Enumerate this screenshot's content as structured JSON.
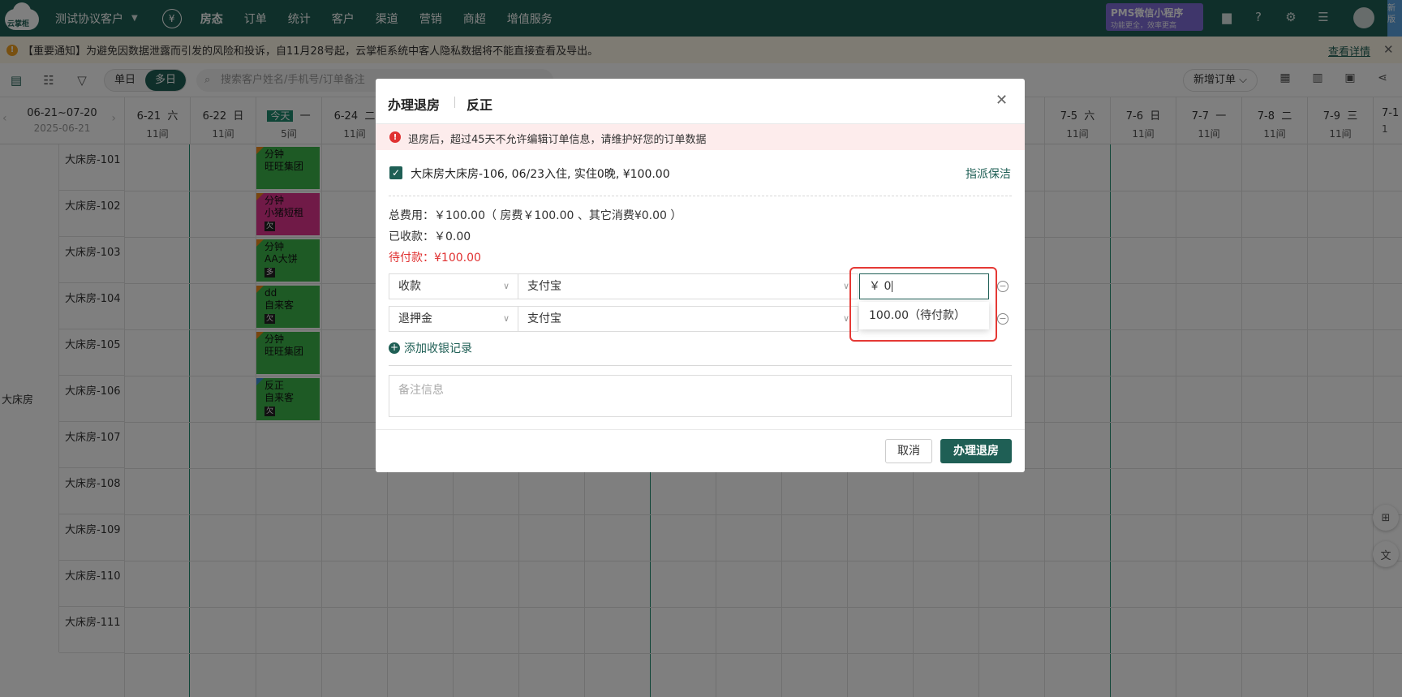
{
  "topnav": {
    "logo_text": "云掌柜",
    "hotel_name": "测试协议客户",
    "links": [
      "房态",
      "订单",
      "统计",
      "客户",
      "渠道",
      "营销",
      "商超",
      "增值服务"
    ],
    "active_link": "房态",
    "pms_title": "PMS微信小程序",
    "pms_subtitle": "功能更全，效率更高",
    "corner_badge": "新版"
  },
  "notice": {
    "text": "【重要通知】为避免因数据泄露而引发的风险和投诉，自11月28号起，云掌柜系统中客人隐私数据将不能直接查看及导出。",
    "link": "查看详情"
  },
  "toolbar": {
    "single_day": "单日",
    "multi_day": "多日",
    "search_placeholder": "搜索客户姓名/手机号/订单备注",
    "new_order": "新增订单"
  },
  "calendar": {
    "range": "06-21~07-20",
    "year_date": "2025-06-21",
    "days": [
      {
        "date": "6-21",
        "weekday": "六",
        "count": "11间"
      },
      {
        "date": "6-22",
        "weekday": "日",
        "count": "11间"
      },
      {
        "date": "今天",
        "weekday": "一",
        "count": "5间"
      },
      {
        "date": "6-24",
        "weekday": "二",
        "count": "11间"
      },
      {
        "date": "7-5",
        "weekday": "六",
        "count": "11间"
      },
      {
        "date": "7-6",
        "weekday": "日",
        "count": "11间"
      },
      {
        "date": "7-7",
        "weekday": "一",
        "count": "11间"
      },
      {
        "date": "7-8",
        "weekday": "二",
        "count": "11间"
      },
      {
        "date": "7-9",
        "weekday": "三",
        "count": "11间"
      },
      {
        "date": "7-1",
        "weekday": "",
        "count": "1"
      }
    ],
    "room_type": "大床房",
    "rooms": [
      "大床房-101",
      "大床房-102",
      "大床房-103",
      "大床房-104",
      "大床房-105",
      "大床房-106",
      "大床房-107",
      "大床房-108",
      "大床房-109",
      "大床房-110",
      "大床房-111"
    ],
    "bookings": [
      {
        "l1": "分钟",
        "l2": "旺旺集团",
        "tag": "",
        "color": "#3cb44b"
      },
      {
        "l1": "分钟",
        "l2": "小猪短租",
        "tag": "欠",
        "color": "#e0358f"
      },
      {
        "l1": "分钟",
        "l2": "AA大饼",
        "tag": "多",
        "color": "#3cb44b"
      },
      {
        "l1": "dd",
        "l2": "自来客",
        "tag": "欠",
        "color": "#3cb44b"
      },
      {
        "l1": "分钟",
        "l2": "旺旺集团",
        "tag": "",
        "color": "#3cb44b"
      },
      {
        "l1": "反正",
        "l2": "自来客",
        "tag": "欠",
        "color": "#3cb44b"
      }
    ]
  },
  "modal": {
    "tab_checkout": "办理退房",
    "tab_reverse": "反正",
    "alert": "退房后，超过45天不允许编辑订单信息，请维护好您的订单数据",
    "room_line": "大床房大床房-106, 06/23入住, 实住0晚, ¥100.00",
    "assign_clean": "指派保洁",
    "total": "总费用：￥100.00（ 房费￥100.00 、其它消费¥0.00 ）",
    "received": "已收款：￥0.00",
    "pending": "待付款：¥100.00",
    "row1_type": "收款",
    "row1_method": "支付宝",
    "row2_type": "退押金",
    "row2_method": "支付宝",
    "amount_value": "￥ 0",
    "dropdown_option": "100.00（待付款）",
    "add_record": "添加收银记录",
    "remark_placeholder": "备注信息",
    "cancel": "取消",
    "confirm": "办理退房"
  }
}
